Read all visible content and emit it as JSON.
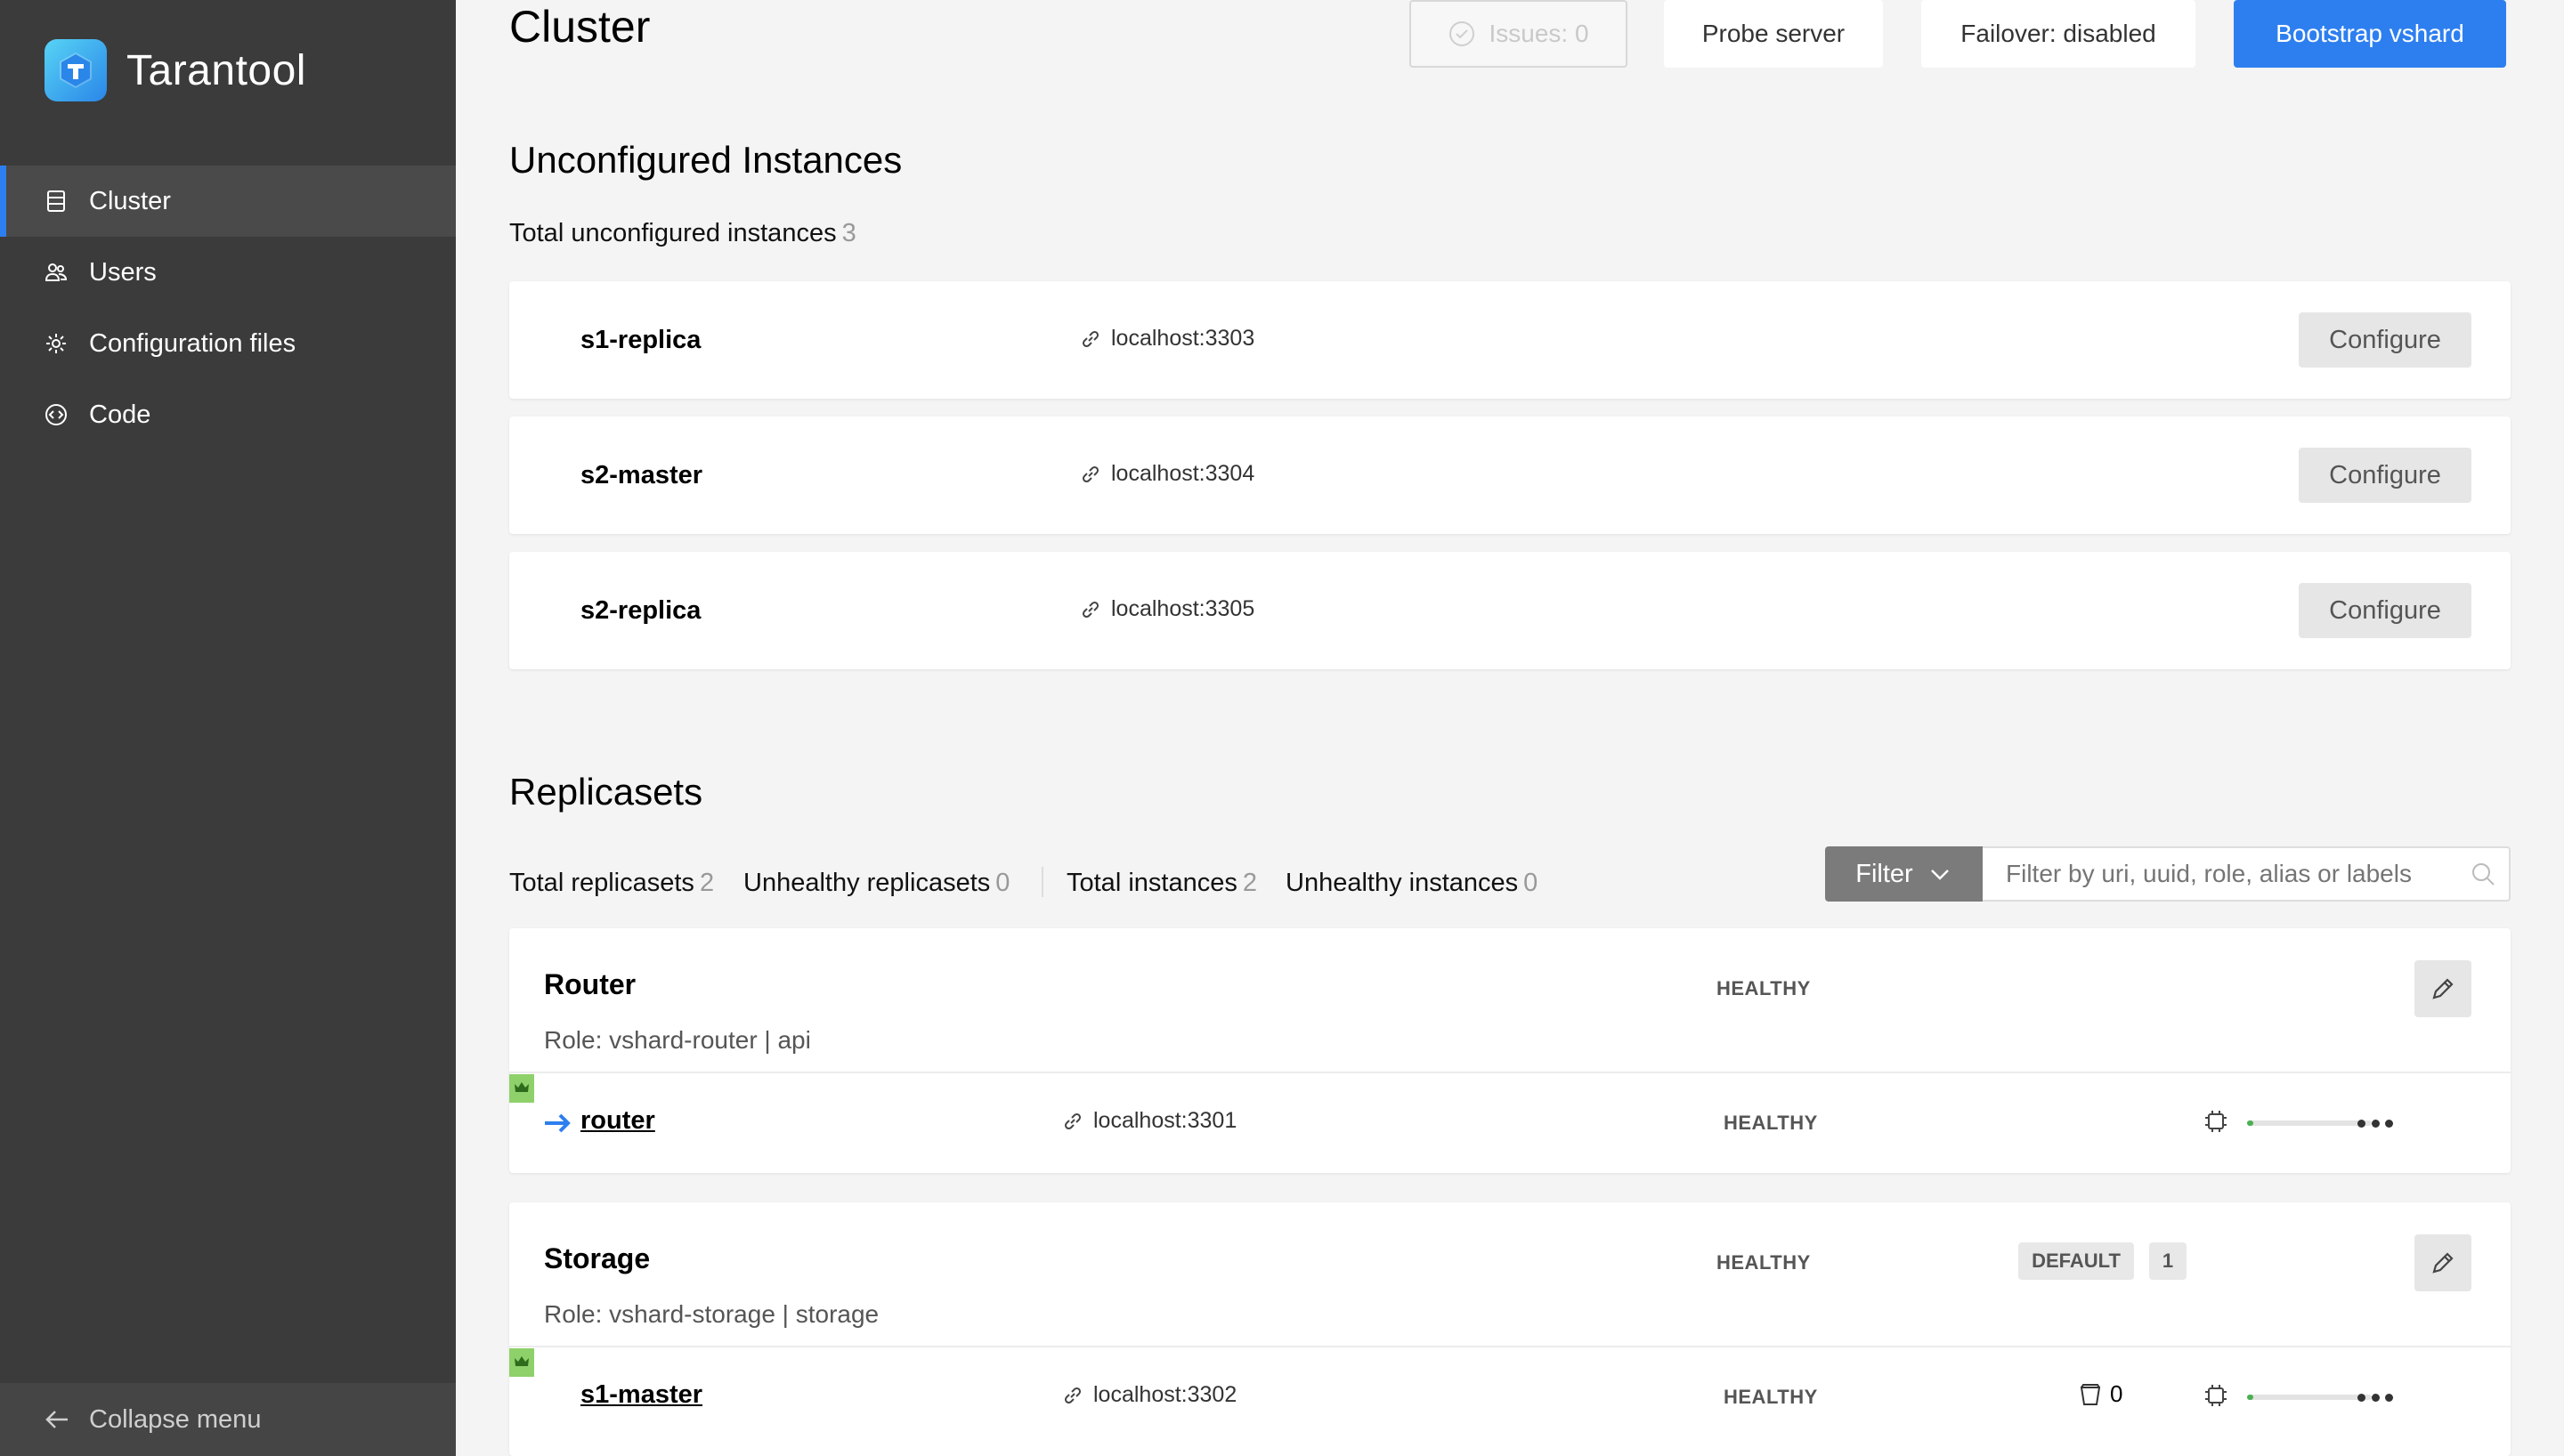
{
  "app": {
    "name": "Tarantool"
  },
  "sidebar": {
    "items": [
      {
        "label": "Cluster",
        "icon": "cluster-icon"
      },
      {
        "label": "Users",
        "icon": "users-icon"
      },
      {
        "label": "Configuration files",
        "icon": "gear-icon"
      },
      {
        "label": "Code",
        "icon": "code-icon"
      }
    ],
    "collapse_label": "Collapse menu"
  },
  "header": {
    "title": "Cluster",
    "issues_label": "Issues: 0",
    "probe_label": "Probe server",
    "failover_label": "Failover: disabled",
    "bootstrap_label": "Bootstrap vshard"
  },
  "unconfigured": {
    "title": "Unconfigured Instances",
    "total_label": "Total unconfigured instances",
    "total_count": "3",
    "configure_label": "Configure",
    "instances": [
      {
        "name": "s1-replica",
        "uri": "localhost:3303"
      },
      {
        "name": "s2-master",
        "uri": "localhost:3304"
      },
      {
        "name": "s2-replica",
        "uri": "localhost:3305"
      }
    ]
  },
  "replicasets": {
    "title": "Replicasets",
    "stats": {
      "total_replicasets_label": "Total replicasets",
      "total_replicasets": "2",
      "unhealthy_replicasets_label": "Unhealthy replicasets",
      "unhealthy_replicasets": "0",
      "total_instances_label": "Total instances",
      "total_instances": "2",
      "unhealthy_instances_label": "Unhealthy instances",
      "unhealthy_instances": "0"
    },
    "filter_label": "Filter",
    "filter_placeholder": "Filter by uri, uuid, role, alias or labels",
    "items": [
      {
        "name": "Router",
        "role": "Role: vshard-router | api",
        "status": "HEALTHY",
        "instance": {
          "name": "router",
          "uri": "localhost:3301",
          "status": "HEALTHY",
          "memory_usage": 0.05
        }
      },
      {
        "name": "Storage",
        "role": "Role: vshard-storage | storage",
        "status": "HEALTHY",
        "group_tag": "DEFAULT",
        "weight": "1",
        "instance": {
          "name": "s1-master",
          "uri": "localhost:3302",
          "status": "HEALTHY",
          "buckets": "0",
          "memory_usage": 0.05
        }
      }
    ]
  },
  "colors": {
    "accent": "#2d7fef",
    "sidebar": "#3b3b3b",
    "leader": "#8ed16a"
  }
}
